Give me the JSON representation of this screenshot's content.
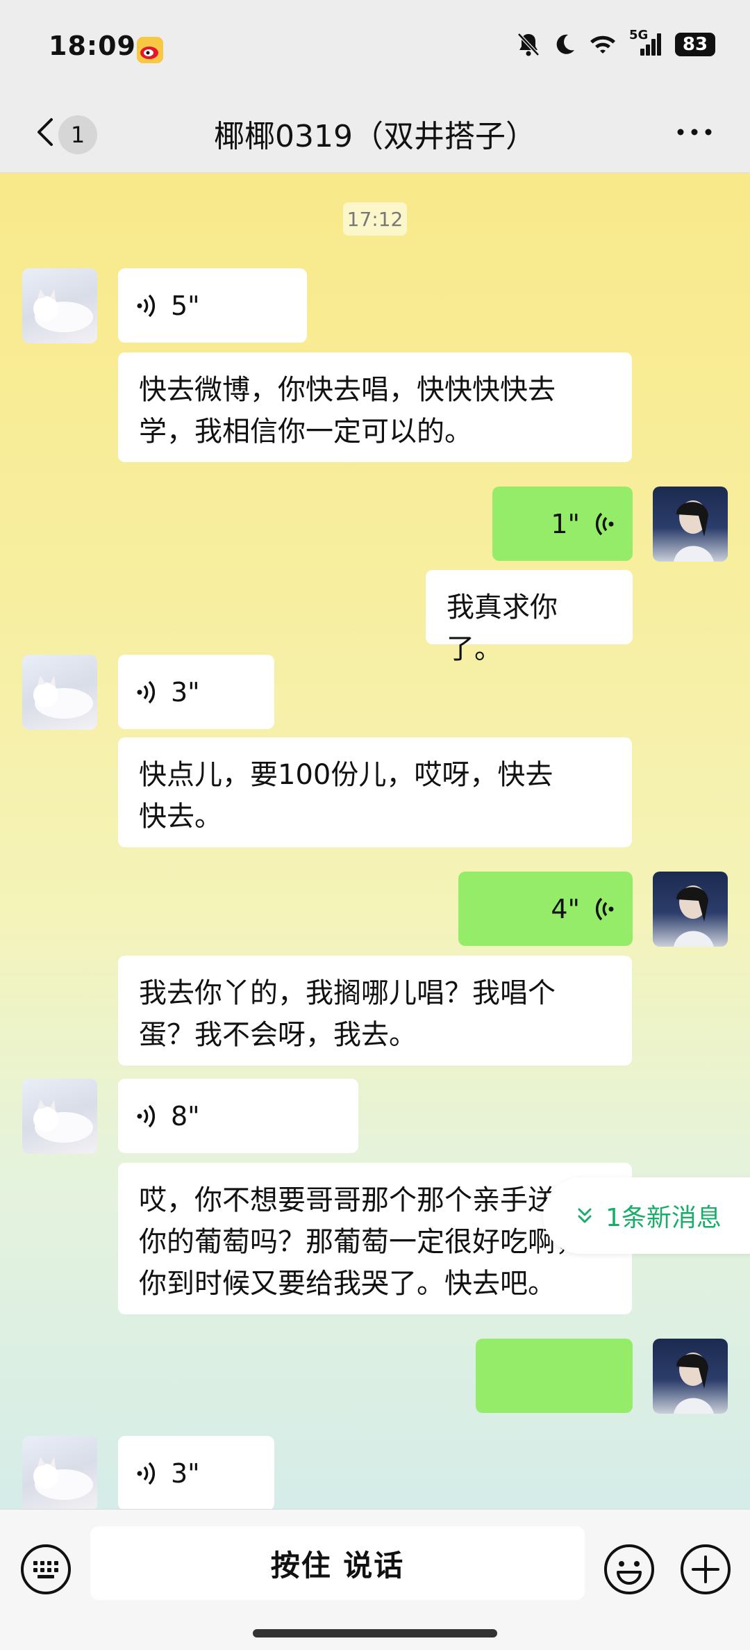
{
  "status_bar": {
    "time": "18:09",
    "network": "5G",
    "battery": "83",
    "icons": [
      "weibo-icon",
      "mute-bell-icon",
      "moon-icon",
      "wifi-icon",
      "signal-icon",
      "battery-icon"
    ]
  },
  "nav": {
    "back_badge": "1",
    "title": "椰椰0319（双井搭子）"
  },
  "chat": {
    "timestamp": "17:12",
    "messages": [
      {
        "side": "left",
        "type": "voice",
        "duration": "5\""
      },
      {
        "side": "left",
        "type": "text",
        "text": "快去微博，你快去唱，快快快快去\n学，我相信你一定可以的。"
      },
      {
        "side": "right",
        "type": "voice",
        "duration": "1\""
      },
      {
        "side": "right",
        "type": "text",
        "text": "我真求你了。"
      },
      {
        "side": "left",
        "type": "voice",
        "duration": "3\""
      },
      {
        "side": "left",
        "type": "text",
        "text": "快点儿，要100份儿，哎呀，快去\n快去。"
      },
      {
        "side": "right",
        "type": "voice",
        "duration": "4\""
      },
      {
        "side": "right",
        "type": "text",
        "text": "我去你丫的，我搁哪儿唱？我唱个\n蛋？我不会呀，我去。"
      },
      {
        "side": "left",
        "type": "voice",
        "duration": "8\""
      },
      {
        "side": "left",
        "type": "text",
        "text": "哎，你不想要哥哥那个那个亲手送\n你的葡萄吗？那葡萄一定很好吃啊，\n你到时候又要给我哭了。快去吧。"
      },
      {
        "side": "right",
        "type": "voice",
        "duration": ""
      },
      {
        "side": "left",
        "type": "voice",
        "duration": "3\""
      }
    ],
    "new_message_label": "1条新消息"
  },
  "input_bar": {
    "hold_to_talk_label": "按住 说话"
  },
  "colors": {
    "my_bubble": "#95ec69",
    "their_bubble": "#ffffff",
    "new_message_accent": "#1aad6a"
  }
}
